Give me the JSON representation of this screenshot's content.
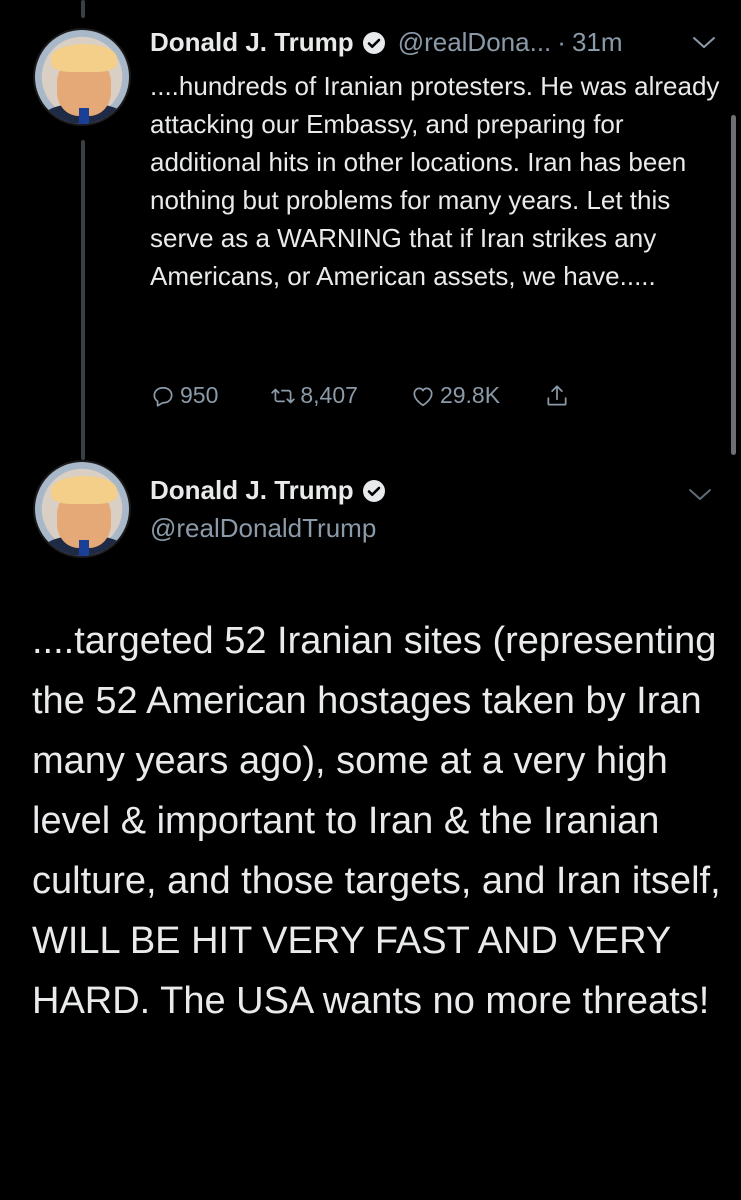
{
  "tweet1": {
    "name": "Donald J. Trump",
    "handle": "@realDona...",
    "separator": "·",
    "time": "31m",
    "text": "....hundreds of Iranian protesters. He was already attacking our Embassy, and preparing for additional hits in other locations. Iran has been nothing but problems for many years. Let this serve as a WARNING that if Iran strikes any Americans, or American assets, we have.....",
    "replies": "950",
    "retweets": "8,407",
    "likes": "29.8K"
  },
  "tweet2": {
    "name": "Donald J. Trump",
    "handle": "@realDonaldTrump",
    "text": "....targeted 52 Iranian sites (representing the 52 American hostages taken by Iran many years ago), some at a very high level & important to Iran &  the Iranian culture, and those targets, and Iran itself, WILL BE HIT VERY FAST AND VERY HARD. The USA wants no more threats!"
  },
  "colors": {
    "background": "#000000",
    "text": "#e9eaeb",
    "secondary": "#8b9aa8",
    "verified": "#e9eaeb"
  },
  "icons": [
    "reply-icon",
    "retweet-icon",
    "like-icon",
    "share-icon",
    "verified-icon",
    "chevron-down-icon"
  ]
}
